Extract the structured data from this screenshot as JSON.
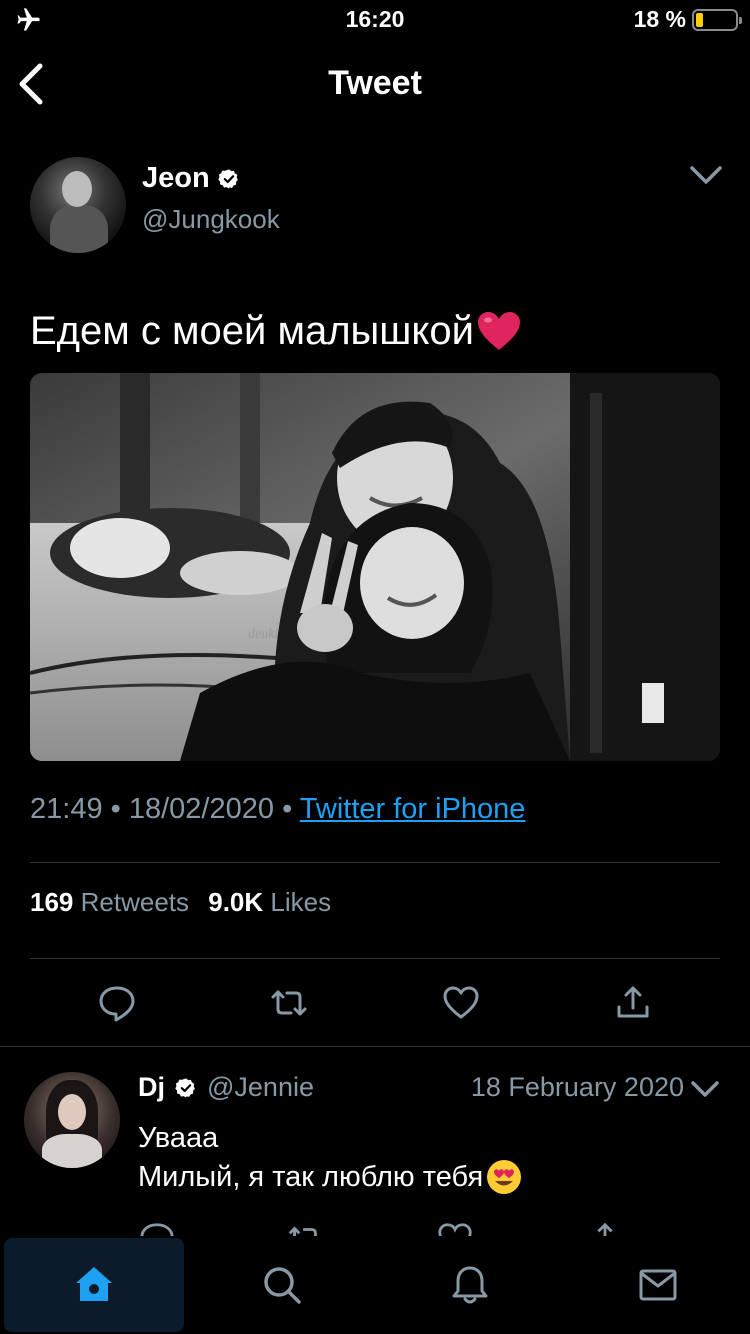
{
  "status_bar": {
    "time": "16:20",
    "battery_percent": "18 %",
    "battery_level": 0.18,
    "airplane_mode": "airplane-icon"
  },
  "nav": {
    "title": "Tweet",
    "back_icon": "chevron-left-icon"
  },
  "tweet": {
    "author_name": "Jeon",
    "author_handle": "@Jungkook",
    "verified": true,
    "text": "Едем с моей малышкой",
    "emoji": "red-heart",
    "time": "21:49",
    "separator": "•",
    "date": "18/02/2020",
    "source": "Twitter for iPhone",
    "retweets_count": "169",
    "retweets_label": "Retweets",
    "likes_count": "9.0K",
    "likes_label": "Likes",
    "photo_watermark": "deuki"
  },
  "actions": [
    "reply-icon",
    "retweet-icon",
    "like-icon",
    "share-icon"
  ],
  "reply": {
    "author_name": "Dj",
    "author_handle": "@Jennie",
    "verified": true,
    "date": "18 February 2020",
    "line1": "Увааа",
    "line2": "Милый, я так люблю тебя",
    "emoji": "heart-eyes"
  },
  "tab_bar": [
    {
      "name": "home",
      "icon": "home-icon",
      "active": true
    },
    {
      "name": "search",
      "icon": "search-icon",
      "active": false
    },
    {
      "name": "notifications",
      "icon": "bell-icon",
      "active": false
    },
    {
      "name": "messages",
      "icon": "mail-icon",
      "active": false
    }
  ],
  "colors": {
    "accent": "#1da1f2",
    "secondary_text": "#8899a6",
    "background": "#000000",
    "battery": "#ffcc00",
    "heart": "#e0245e"
  }
}
